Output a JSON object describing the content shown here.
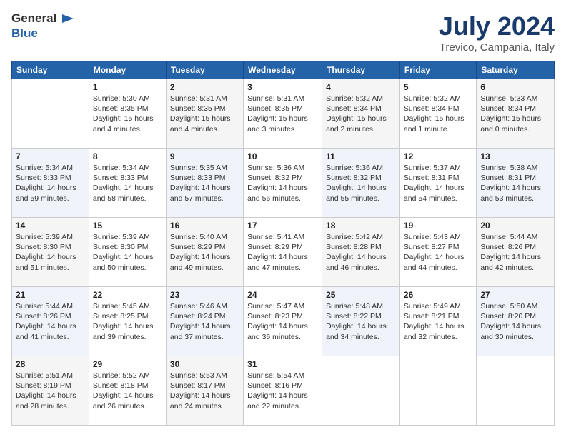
{
  "header": {
    "logo_general": "General",
    "logo_blue": "Blue",
    "month_year": "July 2024",
    "location": "Trevico, Campania, Italy"
  },
  "weekdays": [
    "Sunday",
    "Monday",
    "Tuesday",
    "Wednesday",
    "Thursday",
    "Friday",
    "Saturday"
  ],
  "weeks": [
    [
      {
        "day": "",
        "sunrise": "",
        "sunset": "",
        "daylight": ""
      },
      {
        "day": "1",
        "sunrise": "Sunrise: 5:30 AM",
        "sunset": "Sunset: 8:35 PM",
        "daylight": "Daylight: 15 hours and 4 minutes."
      },
      {
        "day": "2",
        "sunrise": "Sunrise: 5:31 AM",
        "sunset": "Sunset: 8:35 PM",
        "daylight": "Daylight: 15 hours and 4 minutes."
      },
      {
        "day": "3",
        "sunrise": "Sunrise: 5:31 AM",
        "sunset": "Sunset: 8:35 PM",
        "daylight": "Daylight: 15 hours and 3 minutes."
      },
      {
        "day": "4",
        "sunrise": "Sunrise: 5:32 AM",
        "sunset": "Sunset: 8:34 PM",
        "daylight": "Daylight: 15 hours and 2 minutes."
      },
      {
        "day": "5",
        "sunrise": "Sunrise: 5:32 AM",
        "sunset": "Sunset: 8:34 PM",
        "daylight": "Daylight: 15 hours and 1 minute."
      },
      {
        "day": "6",
        "sunrise": "Sunrise: 5:33 AM",
        "sunset": "Sunset: 8:34 PM",
        "daylight": "Daylight: 15 hours and 0 minutes."
      }
    ],
    [
      {
        "day": "7",
        "sunrise": "Sunrise: 5:34 AM",
        "sunset": "Sunset: 8:33 PM",
        "daylight": "Daylight: 14 hours and 59 minutes."
      },
      {
        "day": "8",
        "sunrise": "Sunrise: 5:34 AM",
        "sunset": "Sunset: 8:33 PM",
        "daylight": "Daylight: 14 hours and 58 minutes."
      },
      {
        "day": "9",
        "sunrise": "Sunrise: 5:35 AM",
        "sunset": "Sunset: 8:33 PM",
        "daylight": "Daylight: 14 hours and 57 minutes."
      },
      {
        "day": "10",
        "sunrise": "Sunrise: 5:36 AM",
        "sunset": "Sunset: 8:32 PM",
        "daylight": "Daylight: 14 hours and 56 minutes."
      },
      {
        "day": "11",
        "sunrise": "Sunrise: 5:36 AM",
        "sunset": "Sunset: 8:32 PM",
        "daylight": "Daylight: 14 hours and 55 minutes."
      },
      {
        "day": "12",
        "sunrise": "Sunrise: 5:37 AM",
        "sunset": "Sunset: 8:31 PM",
        "daylight": "Daylight: 14 hours and 54 minutes."
      },
      {
        "day": "13",
        "sunrise": "Sunrise: 5:38 AM",
        "sunset": "Sunset: 8:31 PM",
        "daylight": "Daylight: 14 hours and 53 minutes."
      }
    ],
    [
      {
        "day": "14",
        "sunrise": "Sunrise: 5:39 AM",
        "sunset": "Sunset: 8:30 PM",
        "daylight": "Daylight: 14 hours and 51 minutes."
      },
      {
        "day": "15",
        "sunrise": "Sunrise: 5:39 AM",
        "sunset": "Sunset: 8:30 PM",
        "daylight": "Daylight: 14 hours and 50 minutes."
      },
      {
        "day": "16",
        "sunrise": "Sunrise: 5:40 AM",
        "sunset": "Sunset: 8:29 PM",
        "daylight": "Daylight: 14 hours and 49 minutes."
      },
      {
        "day": "17",
        "sunrise": "Sunrise: 5:41 AM",
        "sunset": "Sunset: 8:29 PM",
        "daylight": "Daylight: 14 hours and 47 minutes."
      },
      {
        "day": "18",
        "sunrise": "Sunrise: 5:42 AM",
        "sunset": "Sunset: 8:28 PM",
        "daylight": "Daylight: 14 hours and 46 minutes."
      },
      {
        "day": "19",
        "sunrise": "Sunrise: 5:43 AM",
        "sunset": "Sunset: 8:27 PM",
        "daylight": "Daylight: 14 hours and 44 minutes."
      },
      {
        "day": "20",
        "sunrise": "Sunrise: 5:44 AM",
        "sunset": "Sunset: 8:26 PM",
        "daylight": "Daylight: 14 hours and 42 minutes."
      }
    ],
    [
      {
        "day": "21",
        "sunrise": "Sunrise: 5:44 AM",
        "sunset": "Sunset: 8:26 PM",
        "daylight": "Daylight: 14 hours and 41 minutes."
      },
      {
        "day": "22",
        "sunrise": "Sunrise: 5:45 AM",
        "sunset": "Sunset: 8:25 PM",
        "daylight": "Daylight: 14 hours and 39 minutes."
      },
      {
        "day": "23",
        "sunrise": "Sunrise: 5:46 AM",
        "sunset": "Sunset: 8:24 PM",
        "daylight": "Daylight: 14 hours and 37 minutes."
      },
      {
        "day": "24",
        "sunrise": "Sunrise: 5:47 AM",
        "sunset": "Sunset: 8:23 PM",
        "daylight": "Daylight: 14 hours and 36 minutes."
      },
      {
        "day": "25",
        "sunrise": "Sunrise: 5:48 AM",
        "sunset": "Sunset: 8:22 PM",
        "daylight": "Daylight: 14 hours and 34 minutes."
      },
      {
        "day": "26",
        "sunrise": "Sunrise: 5:49 AM",
        "sunset": "Sunset: 8:21 PM",
        "daylight": "Daylight: 14 hours and 32 minutes."
      },
      {
        "day": "27",
        "sunrise": "Sunrise: 5:50 AM",
        "sunset": "Sunset: 8:20 PM",
        "daylight": "Daylight: 14 hours and 30 minutes."
      }
    ],
    [
      {
        "day": "28",
        "sunrise": "Sunrise: 5:51 AM",
        "sunset": "Sunset: 8:19 PM",
        "daylight": "Daylight: 14 hours and 28 minutes."
      },
      {
        "day": "29",
        "sunrise": "Sunrise: 5:52 AM",
        "sunset": "Sunset: 8:18 PM",
        "daylight": "Daylight: 14 hours and 26 minutes."
      },
      {
        "day": "30",
        "sunrise": "Sunrise: 5:53 AM",
        "sunset": "Sunset: 8:17 PM",
        "daylight": "Daylight: 14 hours and 24 minutes."
      },
      {
        "day": "31",
        "sunrise": "Sunrise: 5:54 AM",
        "sunset": "Sunset: 8:16 PM",
        "daylight": "Daylight: 14 hours and 22 minutes."
      },
      {
        "day": "",
        "sunrise": "",
        "sunset": "",
        "daylight": ""
      },
      {
        "day": "",
        "sunrise": "",
        "sunset": "",
        "daylight": ""
      },
      {
        "day": "",
        "sunrise": "",
        "sunset": "",
        "daylight": ""
      }
    ]
  ]
}
